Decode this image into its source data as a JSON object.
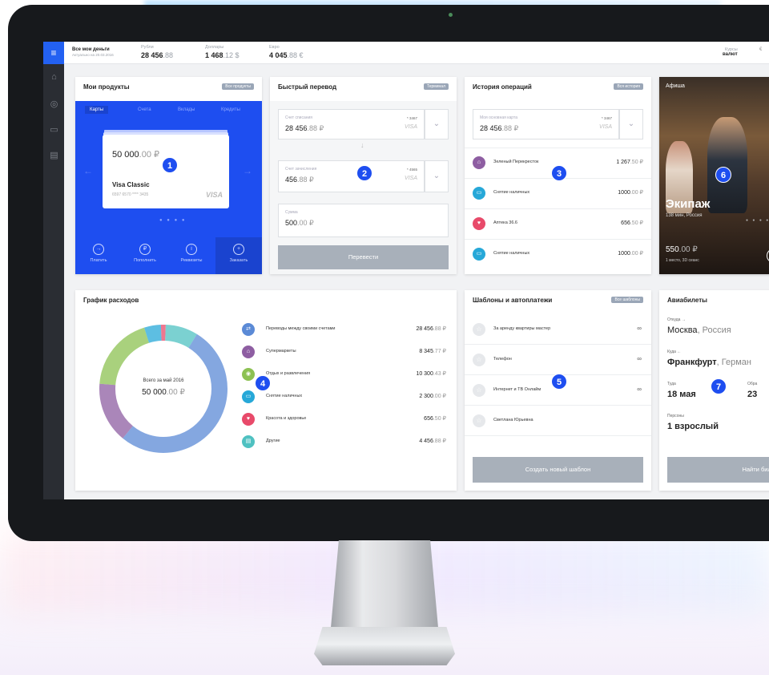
{
  "topbar": {
    "title": "Все мои деньги",
    "subtitle": "Актуально на 20.03.2016",
    "rub_label": "Рубли",
    "rub_value": "28 456",
    "rub_frac": ".88",
    "usd_label": "Доллары",
    "usd_value": "1 468",
    "usd_frac": ".12 $",
    "eur_label": "Евро",
    "eur_value": "4 045",
    "eur_frac": ".88 €",
    "rates_label": "Курсы",
    "rates_value": "валют"
  },
  "sidebar": {
    "icons": [
      "menu-icon",
      "home-icon",
      "user-icon",
      "card-icon",
      "document-icon"
    ]
  },
  "products": {
    "title": "Мои продукты",
    "pill": "Все продукты",
    "tabs": [
      "Карты",
      "Счета",
      "Вклады",
      "Кредиты"
    ],
    "card_amount": "50 000",
    "card_frac": ".00 ₽",
    "card_name": "Visa Classic",
    "card_number": "6597 6570 **** 3435",
    "card_brand": "VISA",
    "actions": [
      "Платить",
      "Пополнить",
      "Реквизиты",
      "Заказать"
    ],
    "badge": "1"
  },
  "transfer": {
    "title": "Быстрый перевод",
    "pill": "Терминал",
    "from_label": "Счет списания",
    "from_value": "28 456",
    "from_frac": ".88 ₽",
    "from_num": "* 3467",
    "from_brand": "VISA",
    "to_label": "Счет зачисления",
    "to_value": "456",
    "to_frac": ".88 ₽",
    "to_num": "* 4565",
    "to_brand": "VISA",
    "sum_label": "Сумма",
    "sum_value": "500",
    "sum_frac": ".00 ₽",
    "button": "Перевести",
    "badge": "2"
  },
  "history": {
    "title": "История операций",
    "pill": "Вся история",
    "card_label": "Моя основная карта",
    "card_value": "28 456",
    "card_frac": ".88 ₽",
    "card_num": "* 3467",
    "card_brand": "VISA",
    "items": [
      {
        "name": "Зеленый Перекресток",
        "value": "1 267",
        "frac": ".50 ₽",
        "color": "#8e5ea2",
        "icon": "cart-icon"
      },
      {
        "name": "Снятие наличных",
        "value": "1000",
        "frac": ".00 ₽",
        "color": "#27a8d8",
        "icon": "cash-icon"
      },
      {
        "name": "Аптека 36.6",
        "value": "656",
        "frac": ".50 ₽",
        "color": "#e84a6a",
        "icon": "heart-icon"
      },
      {
        "name": "Снятие наличных",
        "value": "1000",
        "frac": ".00 ₽",
        "color": "#27a8d8",
        "icon": "cash-icon"
      }
    ],
    "badge": "3"
  },
  "afisha": {
    "title": "Афиша",
    "movie": "Экипаж",
    "meta": "138 мин, Россия",
    "price": "550",
    "price_frac": ".00 ₽",
    "price_meta": "1 место, 3D сеанс",
    "badge": "6"
  },
  "expenses": {
    "title": "График расходов",
    "center_label": "Всего за май 2016",
    "center_value": "50 000",
    "center_frac": ".00 ₽",
    "badge": "4",
    "items": [
      {
        "name": "Переводы между своими счетами",
        "value": "28 456",
        "frac": ".88 ₽",
        "color": "#5b8ad6",
        "icon": "transfer-icon"
      },
      {
        "name": "Супермаркеты",
        "value": "8 345",
        "frac": ".77 ₽",
        "color": "#8e5ea2",
        "icon": "cart-icon"
      },
      {
        "name": "Отдых и развлечения",
        "value": "10 300",
        "frac": ".43 ₽",
        "color": "#8cc152",
        "icon": "leisure-icon"
      },
      {
        "name": "Снятие наличных",
        "value": "2 300",
        "frac": ".00 ₽",
        "color": "#27a8d8",
        "icon": "cash-icon"
      },
      {
        "name": "Красота и здоровье",
        "value": "656",
        "frac": ".50 ₽",
        "color": "#e84a6a",
        "icon": "heart-icon"
      },
      {
        "name": "Другие",
        "value": "4 456",
        "frac": ".88 ₽",
        "color": "#4fc1c1",
        "icon": "other-icon"
      }
    ]
  },
  "chart_data": {
    "type": "pie",
    "categories": [
      "Переводы между своими счетами",
      "Супермаркеты",
      "Отдых и развлечения",
      "Снятие наличных",
      "Красота и здоровье",
      "Другие"
    ],
    "values": [
      28456.88,
      8345.77,
      10300.43,
      2300.0,
      656.5,
      4456.88
    ],
    "title": "График расходов"
  },
  "templates": {
    "title": "Шаблоны и автоплатежи",
    "pill": "Все шаблоны",
    "items": [
      {
        "name": "За аренду квартиры мастер",
        "link": true
      },
      {
        "name": "Телефон",
        "link": true
      },
      {
        "name": "Интернет и ТВ Онлайм",
        "link": true
      },
      {
        "name": "Светлана Юрьевна",
        "link": false
      }
    ],
    "button": "Создать новый шаблон",
    "badge": "5"
  },
  "avia": {
    "title": "Авиабилеты",
    "from_label": "Откуда →",
    "from_city": "Москва",
    "from_country": ", Россия",
    "to_label": "Куда ←",
    "to_city": "Франкфурт",
    "to_country": ", Герман",
    "there_label": "Туда",
    "there_value": "18 мая",
    "back_label": "Обра",
    "back_value": "23",
    "persons_label": "Персоны",
    "persons_value": "1 взрослый",
    "button": "Найти биле",
    "badge": "7"
  }
}
